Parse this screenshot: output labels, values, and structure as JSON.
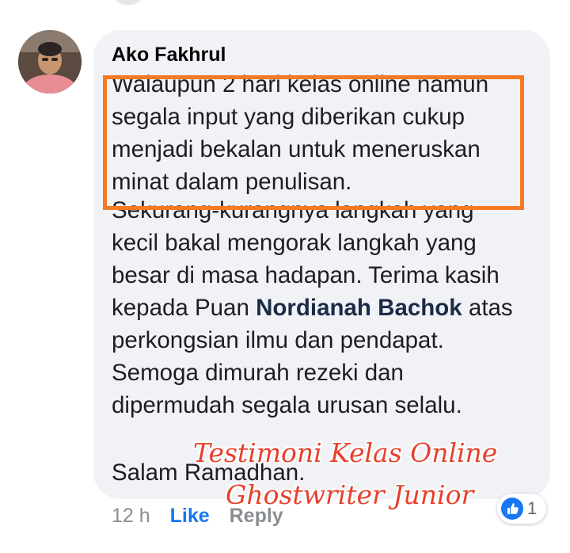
{
  "comment": {
    "author": "Ako Fakhrul",
    "highlighted_lines": [
      "Walaupun 2 hari kelas online namun",
      "segala input yang diberikan cukup",
      "menjadi bekalan untuk meneruskan",
      "minat dalam penulisan."
    ],
    "rest_lines_before_mention": [
      "Sekurang-kurangnya langkah yang",
      "kecil bakal mengorak langkah yang",
      "besar di masa hadapan. Terima kasih"
    ],
    "mention_prefix": "kepada Puan ",
    "mention_name": "Nordianah Bachok",
    "mention_suffix": " atas",
    "rest_lines_after_mention": [
      "perkongsian ilmu dan pendapat.",
      "Semoga dimurah rezeki dan",
      "dipermudah segala urusan selalu."
    ],
    "closing": "Salam Ramadhan."
  },
  "watermark": {
    "line1": "Testimoni Kelas Online",
    "line2": "Ghostwriter Junior"
  },
  "actions": {
    "time": "12 h",
    "like_label": "Like",
    "reply_label": "Reply"
  },
  "reactions": {
    "icon": "like-icon",
    "count": "1"
  },
  "colors": {
    "bubble": "#f0f2f5",
    "highlight_border": "#f57a22",
    "like_link": "#1877f2",
    "watermark": "#e8402d"
  }
}
